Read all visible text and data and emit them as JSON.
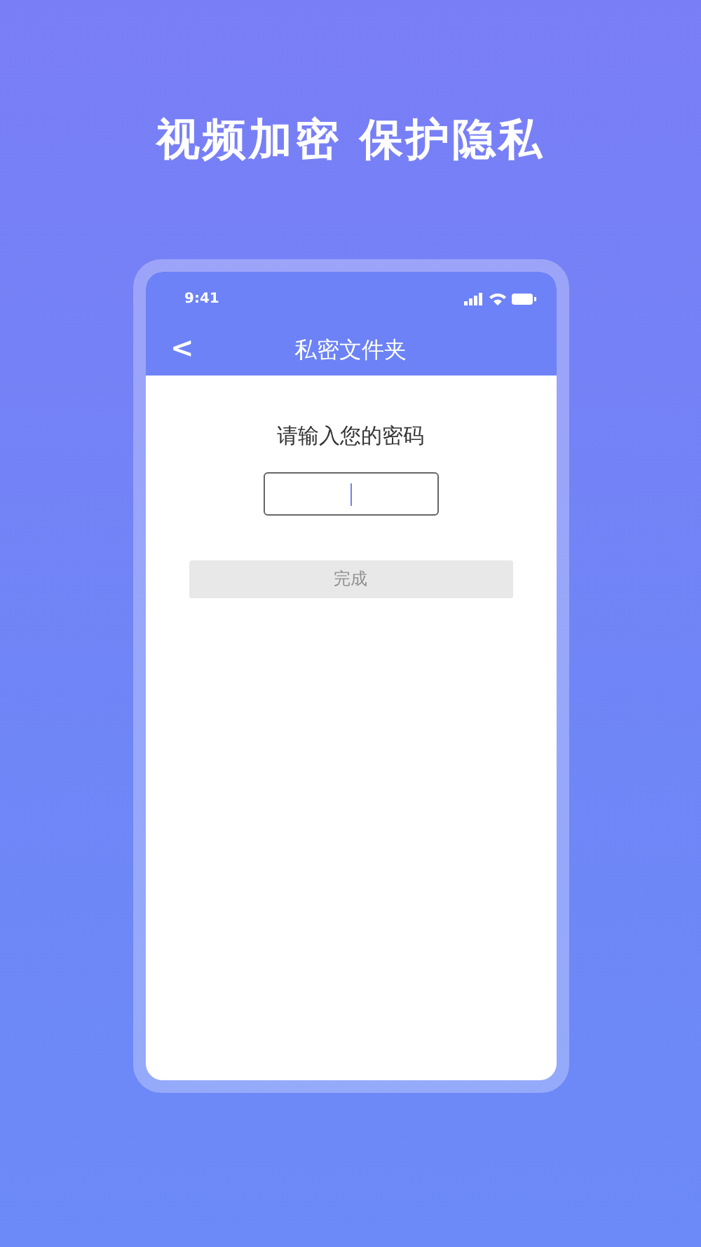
{
  "headline": "视频加密 保护隐私",
  "phone": {
    "status_bar": {
      "time": "9:41"
    },
    "nav": {
      "back": "<",
      "title": "私密文件夹"
    },
    "prompt": "请输入您的密码",
    "password_field": {
      "focused": true
    },
    "done_button": {
      "label": "完成",
      "disabled": true
    }
  }
}
